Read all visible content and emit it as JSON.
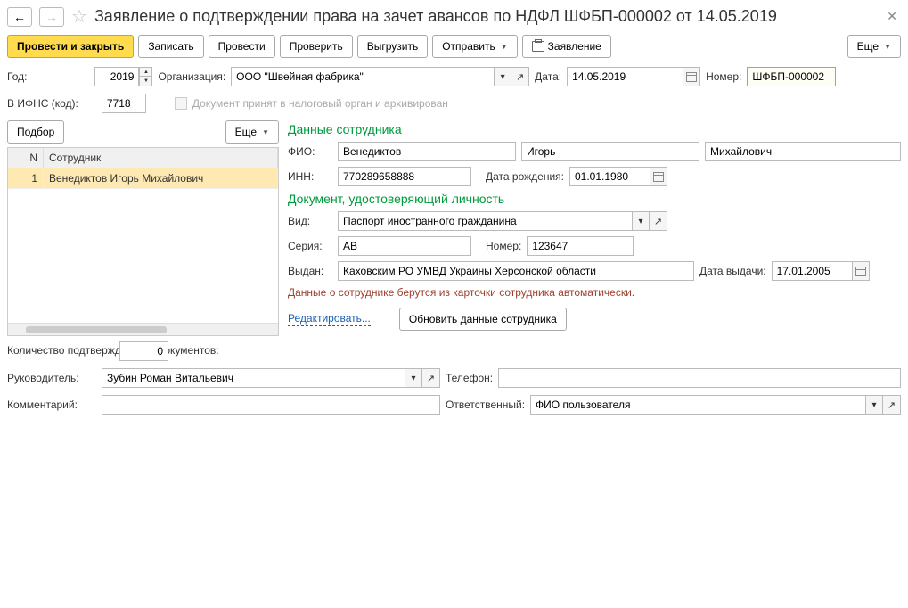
{
  "title": "Заявление о подтверждении права на зачет авансов по НДФЛ ШФБП-000002 от 14.05.2019",
  "toolbar": {
    "post_close": "Провести и закрыть",
    "save": "Записать",
    "post": "Провести",
    "check": "Проверить",
    "export": "Выгрузить",
    "send": "Отправить",
    "print": "Заявление",
    "more": "Еще"
  },
  "fields": {
    "year_lbl": "Год:",
    "year": "2019",
    "org_lbl": "Организация:",
    "org": "ООО \"Швейная фабрика\"",
    "date_lbl": "Дата:",
    "date": "14.05.2019",
    "num_lbl": "Номер:",
    "num": "ШФБП-000002",
    "ifns_lbl": "В ИФНС (код):",
    "ifns": "7718",
    "archived": "Документ принят в налоговый орган и архивирован"
  },
  "left": {
    "pick": "Подбор",
    "more": "Еще",
    "col_n": "N",
    "col_emp": "Сотрудник",
    "rows": [
      {
        "n": "1",
        "emp": "Венедиктов Игорь Михайлович"
      }
    ]
  },
  "emp": {
    "title": "Данные сотрудника",
    "fio_lbl": "ФИО:",
    "last": "Венедиктов",
    "first": "Игорь",
    "middle": "Михайлович",
    "inn_lbl": "ИНН:",
    "inn": "770289658888",
    "birth_lbl": "Дата рождения:",
    "birth": "01.01.1980"
  },
  "doc": {
    "title": "Документ, удостоверяющий личность",
    "kind_lbl": "Вид:",
    "kind": "Паспорт иностранного гражданина",
    "series_lbl": "Серия:",
    "series": "АВ",
    "num_lbl": "Номер:",
    "num": "123647",
    "issued_lbl": "Выдан:",
    "issued": "Каховским РО УМВД Украины Херсонской области",
    "issue_date_lbl": "Дата выдачи:",
    "issue_date": "17.01.2005",
    "note": "Данные о сотруднике берутся из карточки сотрудника автоматически.",
    "edit": "Редактировать...",
    "refresh": "Обновить данные сотрудника"
  },
  "footer": {
    "count_lbl": "Количество подтверждающих документов:",
    "count": "0",
    "manager_lbl": "Руководитель:",
    "manager": "Зубин Роман Витальевич",
    "phone_lbl": "Телефон:",
    "phone": "",
    "comment_lbl": "Комментарий:",
    "comment": "",
    "responsible_lbl": "Ответственный:",
    "responsible": "ФИО пользователя"
  }
}
